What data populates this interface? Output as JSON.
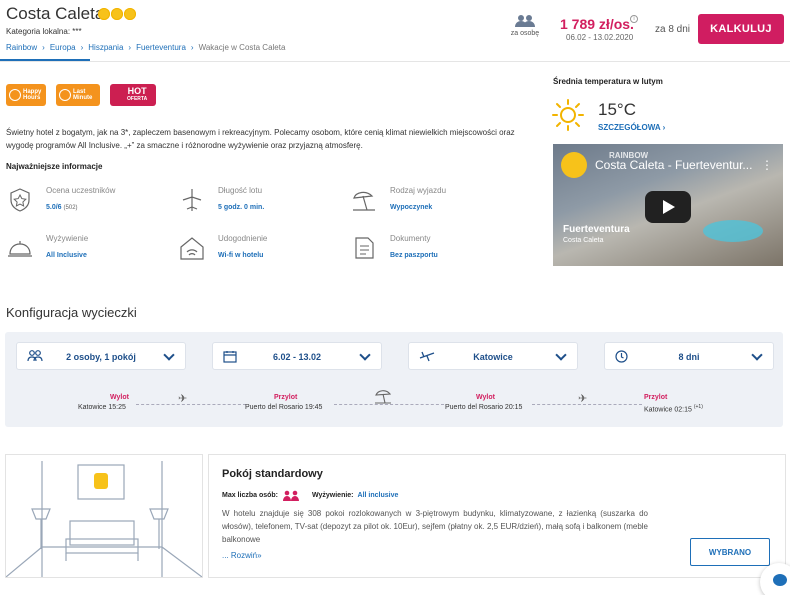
{
  "header": {
    "hotel_name": "Costa Caleta",
    "local_category": "Kategoria lokalna: ***",
    "breadcrumb": [
      "Rainbow",
      "Europa",
      "Hiszpania",
      "Fuerteventura",
      "Wakacje w Costa Caleta"
    ],
    "people_caption": "za osobę",
    "price": "1 789 zł/os.",
    "price_dates": "06.02 - 13.02.2020",
    "days": "za 8 dni",
    "calc_button": "KALKULUJ"
  },
  "badges": {
    "happy": [
      "Happy",
      "Hours"
    ],
    "last": [
      "Last",
      "Minute"
    ],
    "hot": [
      "HOT",
      "OFERTA"
    ]
  },
  "description": "Świetny hotel z bogatym, jak na 3*, zapleczem basenowym i rekreacyjnym. Polecamy osobom, które cenią klimat niewielkich miejscowości oraz wygodę programów All Inclusive. „+” za smaczne i różnorodne wyżywienie oraz przyjazną atmosferę.",
  "info_heading": "Najważniejsze informacje",
  "info": {
    "rating_label": "Ocena uczestników",
    "rating_value": "5.0/6",
    "rating_count": "(502)",
    "flight_label": "Długość lotu",
    "flight_value": "5 godz. 0 min.",
    "trip_label": "Rodzaj wyjazdu",
    "trip_value": "Wypoczynek",
    "food_label": "Wyżywienie",
    "food_value": "All Inclusive",
    "amen_label": "Udogodnienie",
    "amen_value": "Wi-fi w hotelu",
    "docs_label": "Dokumenty",
    "docs_value": "Bez paszportu"
  },
  "weather": {
    "heading": "Średnia temperatura w lutym",
    "temp": "15°C",
    "details": "SZCZEGÓŁOWA"
  },
  "video": {
    "title": "Costa Caleta - Fuerteventur...",
    "brand": "RAINBOW",
    "destination": "Fuerteventura",
    "subtitle": "Costa Caleta"
  },
  "config": {
    "title": "Konfiguracja wycieczki",
    "selects": [
      "2 osoby, 1 pokój",
      "6.02 - 13.02",
      "Katowice",
      "8 dni"
    ],
    "flights": [
      {
        "label": "Wylot",
        "place": "Katowice 15:25"
      },
      {
        "label": "Przylot",
        "place": "Puerto del Rosario 19:45"
      },
      {
        "label": "Wylot",
        "place": "Puerto del Rosario 20:15"
      },
      {
        "label": "Przylot",
        "place": "Katowice 02:15"
      }
    ],
    "next_day": "(+1)"
  },
  "room": {
    "title": "Pokój standardowy",
    "max_label": "Max liczba osób:",
    "food_label": "Wyżywienie:",
    "food_value": "All inclusive",
    "desc": "W hotelu znajduje się 308 pokoi rozlokowanych w 3-piętrowym budynku, klimatyzowane, z łazienką (suszarka do włosów), telefonem, TV-sat (depozyt za pilot ok. 10Eur), sejfem (płatny ok. 2,5 EUR/dzień), małą sofą i balkonem (meble balkonowe",
    "more": "... Rozwiń»",
    "button": "WYBRANO"
  },
  "colors": {
    "brand_pink": "#d01d61",
    "link_blue": "#1e6fb8",
    "badge_orange": "#f4931d"
  }
}
